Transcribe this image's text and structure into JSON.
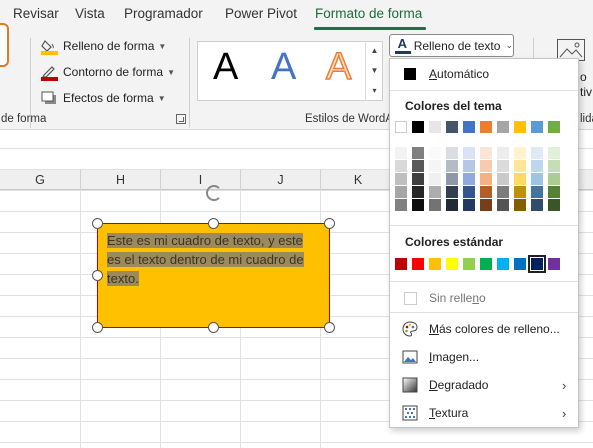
{
  "tabs": [
    {
      "label": "Revisar",
      "active": false
    },
    {
      "label": "Vista",
      "active": false
    },
    {
      "label": "Programador",
      "active": false
    },
    {
      "label": "Power Pivot",
      "active": false
    },
    {
      "label": "Formato de forma",
      "active": true
    }
  ],
  "ribbon": {
    "shape_fill": "Relleno de forma",
    "shape_outline": "Contorno de forma",
    "shape_effects": "Efectos de forma",
    "group_shape_styles": "de forma",
    "group_wordart_styles": "Estilos de WordA",
    "group_right_partial": "lida",
    "right_partial_text_1": "o",
    "right_partial_text_2": "tiv",
    "wordart_letter": "A",
    "text_fill_button": "Relleno de texto"
  },
  "sheet": {
    "columns": [
      "G",
      "H",
      "I",
      "J",
      "K"
    ],
    "textbox_text": "Este es mi cuadro de texto, y este es el texto dentro de mi cuadro de texto."
  },
  "dropdown": {
    "automatic": "Automático",
    "theme_colors_header": "Colores del tema",
    "standard_colors_header": "Colores estándar",
    "no_fill": "Sin relleno",
    "more_colors": "Más colores de relleno...",
    "image": "Imagen...",
    "gradient": "Degradado",
    "texture": "Textura"
  },
  "colors": {
    "accent_tab": "#1e6b3a",
    "shape_fill": "#ffc000",
    "shape_outline": "#c00000",
    "theme_top_row": [
      "#ffffff",
      "#000000",
      "#e7e6e6",
      "#44546a",
      "#4472c4",
      "#ed7d31",
      "#a5a5a5",
      "#ffc000",
      "#5b9bd5",
      "#70ad47"
    ],
    "standard_row": [
      "#c00000",
      "#ff0000",
      "#ffc000",
      "#ffff00",
      "#92d050",
      "#00b050",
      "#00b0f0",
      "#0070c0",
      "#002060",
      "#7030a0"
    ],
    "selected_standard_index": 8
  }
}
